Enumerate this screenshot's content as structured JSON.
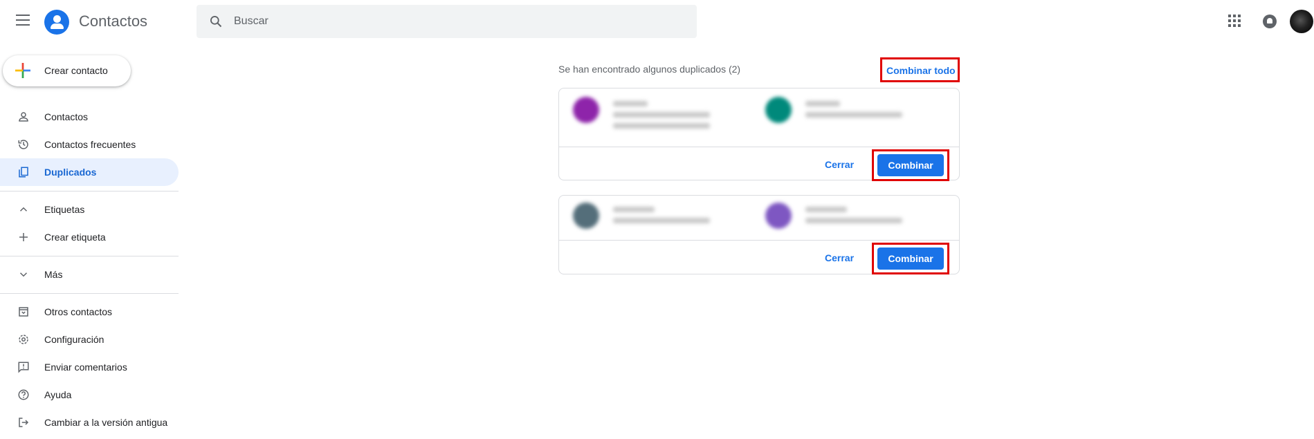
{
  "header": {
    "app_title": "Contactos",
    "search_placeholder": "Buscar"
  },
  "sidebar": {
    "create_label": "Crear contacto",
    "items": [
      {
        "label": "Contactos",
        "icon": "person-icon"
      },
      {
        "label": "Contactos frecuentes",
        "icon": "history-icon"
      },
      {
        "label": "Duplicados",
        "icon": "copy-icon",
        "active": true
      },
      {
        "label": "Etiquetas",
        "icon": "chevron-up-icon"
      },
      {
        "label": "Crear etiqueta",
        "icon": "plus-icon"
      },
      {
        "label": "Más",
        "icon": "chevron-down-icon"
      },
      {
        "label": "Otros contactos",
        "icon": "archive-icon"
      },
      {
        "label": "Configuración",
        "icon": "gear-icon"
      },
      {
        "label": "Enviar comentarios",
        "icon": "feedback-icon"
      },
      {
        "label": "Ayuda",
        "icon": "help-icon"
      },
      {
        "label": "Cambiar a la versión antigua",
        "icon": "exit-icon"
      }
    ]
  },
  "main": {
    "found_text": "Se han encontrado algunos duplicados (2)",
    "merge_all_label": "Combinar todo",
    "cards": [
      {
        "close_label": "Cerrar",
        "merge_label": "Combinar",
        "avatar_colors": [
          "#8e24aa",
          "#00897b"
        ]
      },
      {
        "close_label": "Cerrar",
        "merge_label": "Combinar",
        "avatar_colors": [
          "#546e7a",
          "#7e57c2"
        ]
      }
    ]
  },
  "colors": {
    "accent": "#1a73e8",
    "highlight": "#e00000",
    "active_bg": "#e8f0fe"
  }
}
